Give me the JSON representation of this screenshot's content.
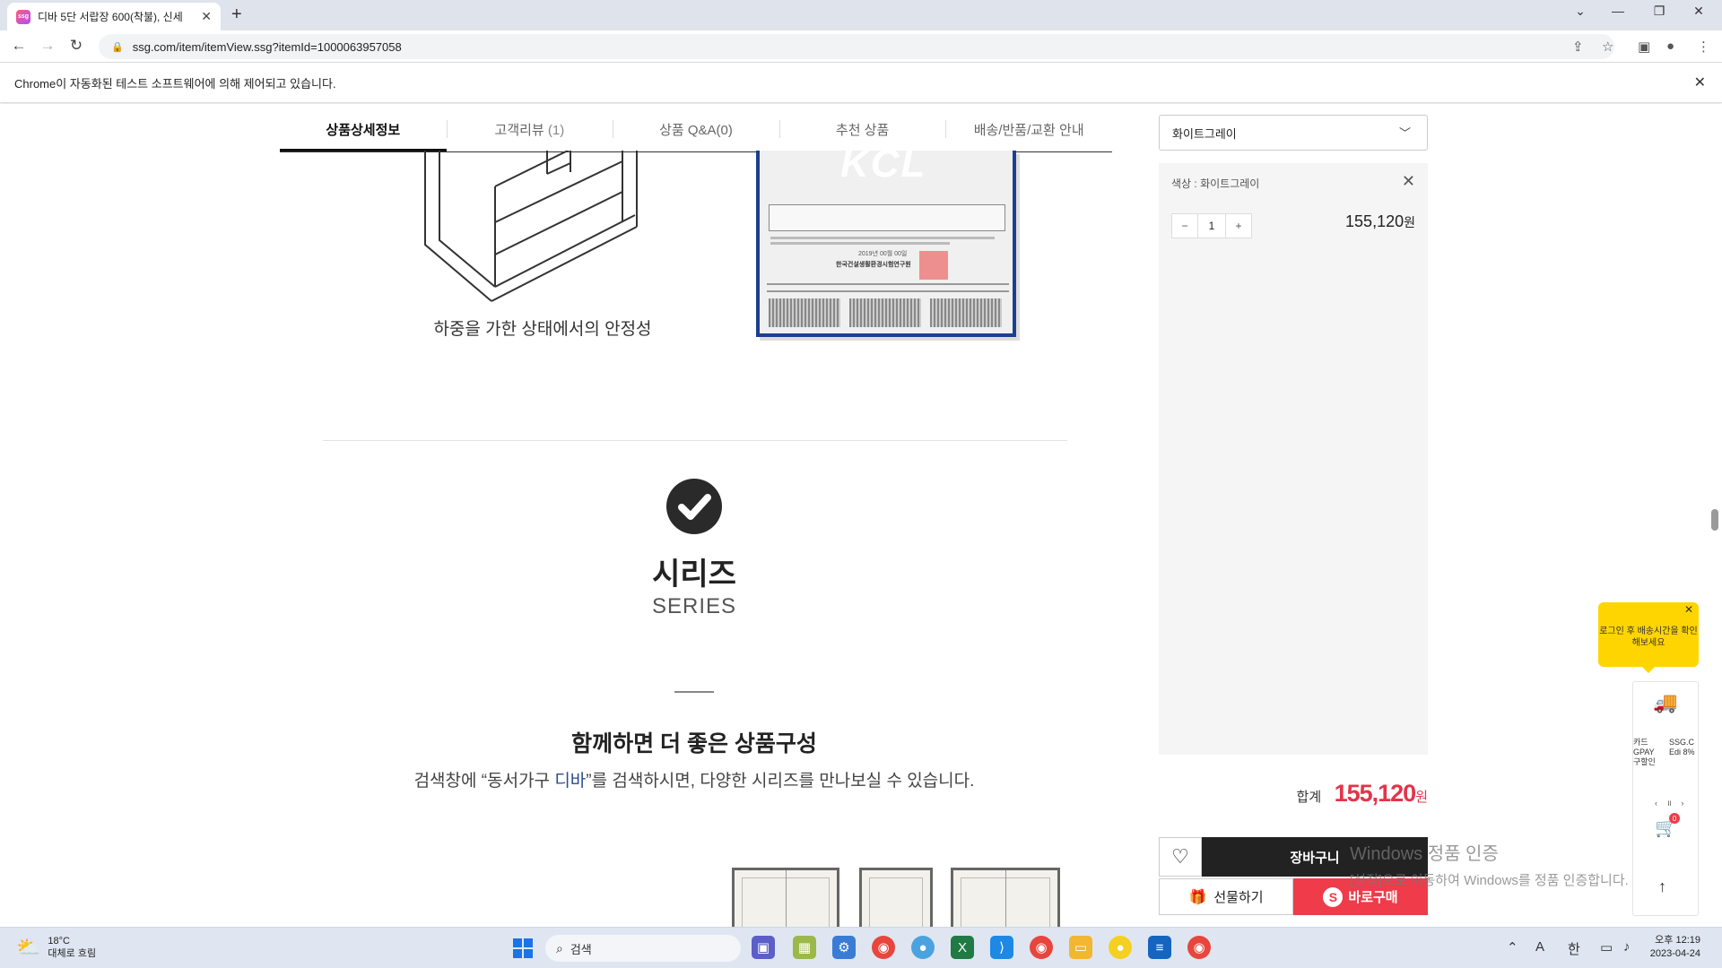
{
  "browser": {
    "tab_title": "디바 5단 서랍장 600(착불), 신세",
    "favicon_text": "ssg",
    "url": "ssg.com/item/itemView.ssg?itemId=1000063957058",
    "automation_notice": "Chrome이 자동화된 테스트 소프트웨어에 의해 제어되고 있습니다."
  },
  "product_tabs": [
    {
      "label": "상품상세정보"
    },
    {
      "label": "고객리뷰",
      "count": "(1)"
    },
    {
      "label": "상품 Q&A(0)"
    },
    {
      "label": "추천 상품"
    },
    {
      "label": "배송/반품/교환 안내"
    }
  ],
  "content": {
    "stability_caption": "하중을 가한 상태에서의 안정성",
    "cert_logo": "KCL",
    "cert_date": "2019년 00월 00일",
    "cert_org": "한국건설생활환경시험연구원",
    "series_title": "시리즈",
    "series_subtitle": "SERIES",
    "together_title": "함께하면 더 좋은 상품구성",
    "together_sub_before": "검색창에 “동서가구 ",
    "together_sub_keyword": "디바",
    "together_sub_after": "”를 검색하시면, 다양한 시리즈를 만나보실 수 있습니다."
  },
  "purchase": {
    "selected_option": "화이트그레이",
    "option_label": "색상 : 화이트그레이",
    "quantity": "1",
    "qty_minus": "−",
    "qty_plus": "+",
    "item_price": "155,120",
    "currency": "원",
    "total_label": "합계",
    "total_price": "155,120",
    "cart_label": "장바구니",
    "gift_label": "선물하기",
    "buy_label": "바로구매",
    "accent_color": "#e3344a"
  },
  "floating": {
    "tooltip": "로그인 후 배송시간을 확인해보세요",
    "ad_left": "카드 GPAY 구할인",
    "ad_right": "SSG.C Edi 8%",
    "cart_badge": "0"
  },
  "watermark": {
    "line1": "Windows 정품 인증",
    "line2": "[설정]으로 이동하여 Windows를 정품 인증합니다."
  },
  "taskbar": {
    "temp": "18°C",
    "weather": "대체로 흐림",
    "search_placeholder": "검색",
    "ime_a": "A",
    "ime_han": "한",
    "time": "오후 12:19",
    "date": "2023-04-24"
  }
}
